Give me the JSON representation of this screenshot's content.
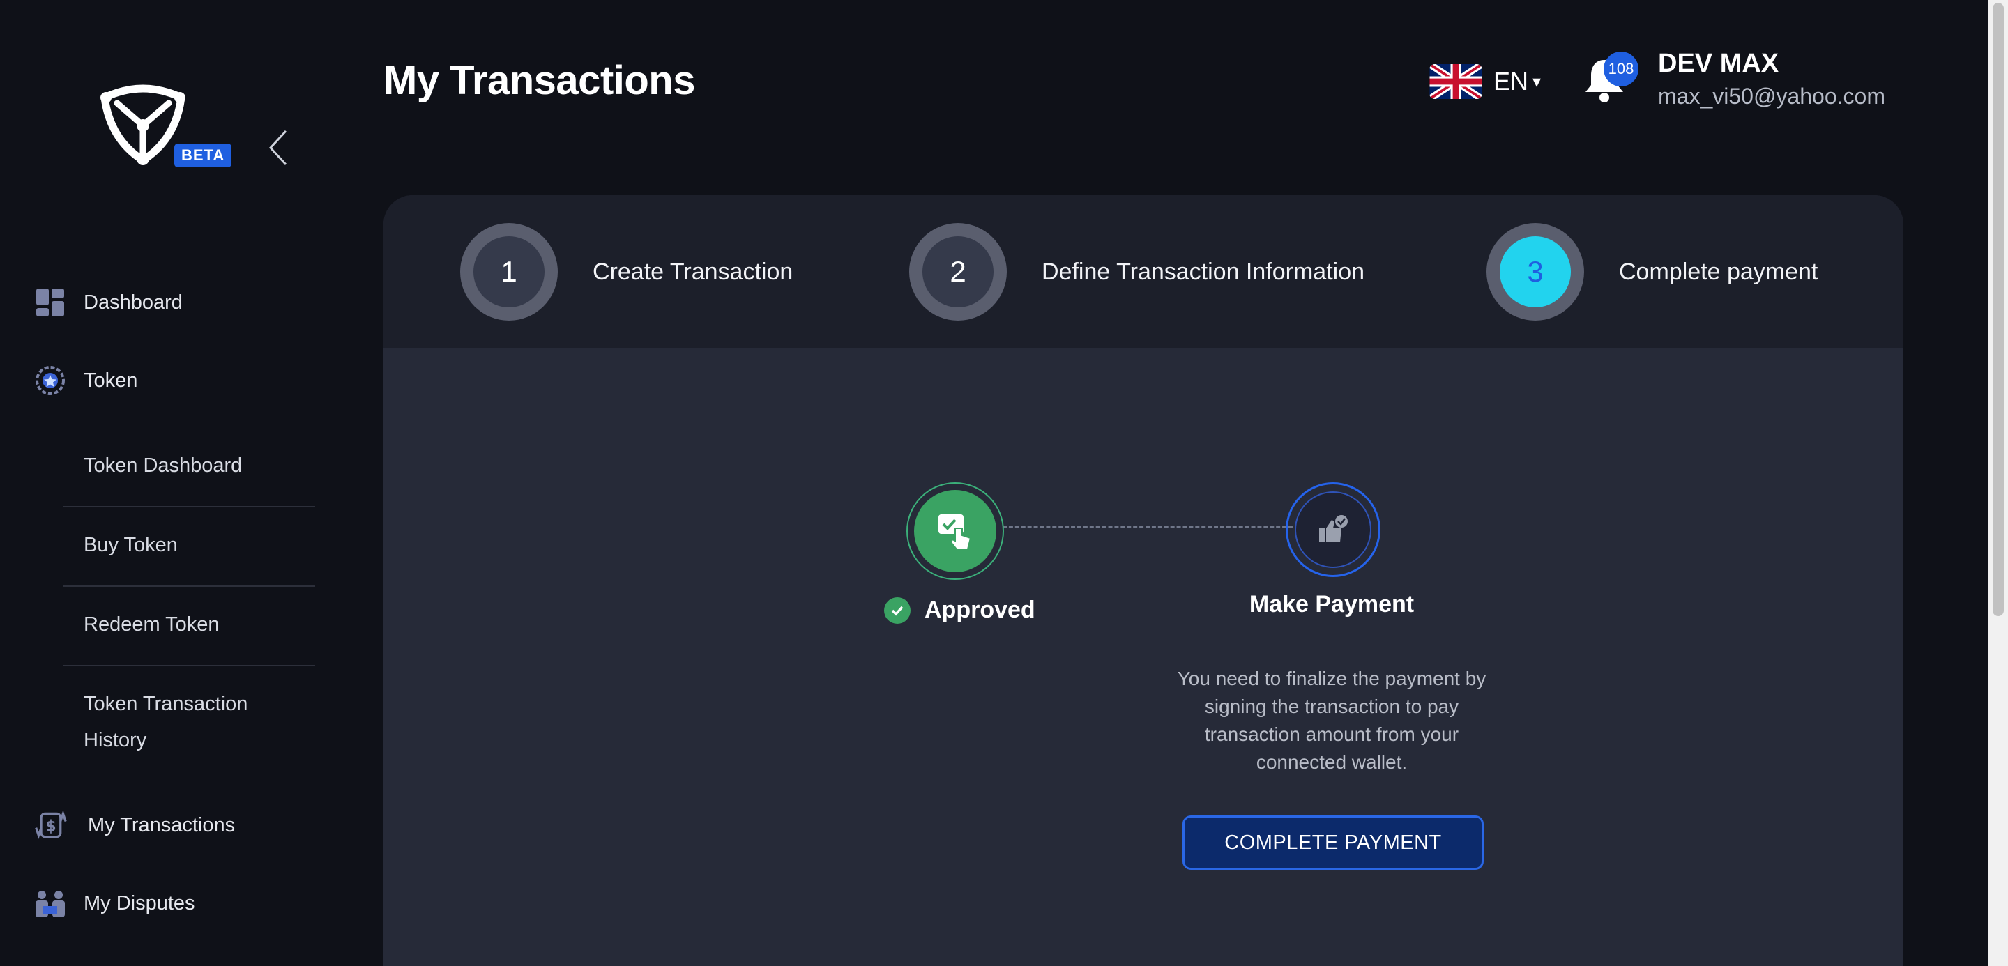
{
  "sidebar": {
    "beta_badge": "BETA",
    "items": [
      {
        "label": "Dashboard"
      },
      {
        "label": "Token"
      },
      {
        "label": "My Transactions"
      },
      {
        "label": "My Disputes"
      }
    ],
    "token_submenu": [
      {
        "label": "Token Dashboard"
      },
      {
        "label": "Buy Token"
      },
      {
        "label": "Redeem Token"
      },
      {
        "label": "Token Transaction"
      },
      {
        "label": "History"
      }
    ]
  },
  "header": {
    "title": "My Transactions",
    "language": {
      "code": "EN",
      "caret": "▾"
    },
    "notifications": {
      "count": "108"
    },
    "user": {
      "name": "DEV MAX",
      "email": "max_vi50@yahoo.com"
    }
  },
  "stepper": {
    "steps": [
      {
        "number": "1",
        "label": "Create Transaction"
      },
      {
        "number": "2",
        "label": "Define Transaction Information"
      },
      {
        "number": "3",
        "label": "Complete payment"
      }
    ],
    "active_step": 3
  },
  "payment_flow": {
    "approved_label": "Approved",
    "make_payment_label": "Make Payment",
    "description": "You need to finalize the payment by signing the transaction to pay transaction amount from your connected wallet.",
    "button_label": "COMPLETE PAYMENT"
  },
  "colors": {
    "background": "#0f1118",
    "card": "#262a38",
    "stepper_bg": "#1c1f2a",
    "accent_blue": "#1f5fe0",
    "active_step": "#22d3ee",
    "approved_green": "#3aa363"
  }
}
